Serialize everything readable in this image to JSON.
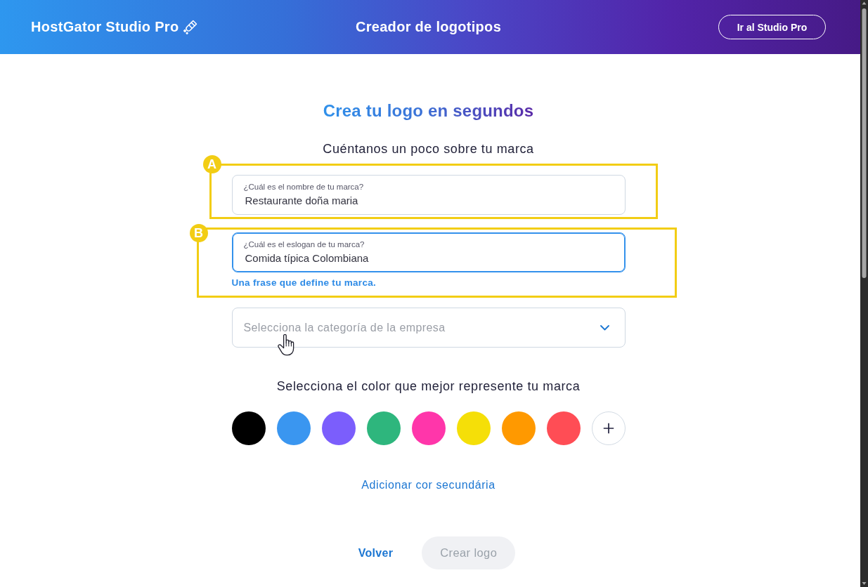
{
  "header": {
    "brand": "HostGator Studio Pro",
    "title": "Creador de logotipos",
    "action_button": "Ir al Studio Pro"
  },
  "form": {
    "heading": "Crea tu logo en segundos",
    "subheading": "Cuéntanos un poco sobre tu marca",
    "fields": [
      {
        "label": "¿Cuál es el nombre de tu marca?",
        "value": "Restaurante doña maria",
        "focused": false,
        "annotation": "A"
      },
      {
        "label": "¿Cuál es el eslogan de tu marca?",
        "value": "Comida típica Colombiana",
        "focused": true,
        "hint": "Una frase que define tu marca.",
        "annotation": "B"
      }
    ],
    "category_select": {
      "placeholder": "Selecciona la categoría de la empresa"
    },
    "color_heading": "Selecciona el color que mejor represente tu marca",
    "colors": [
      {
        "color": "#000000",
        "selected": false
      },
      {
        "color": "#3a96f0",
        "selected": false
      },
      {
        "color": "#7b5efc",
        "selected": false
      },
      {
        "color": "#2eb67d",
        "selected": false
      },
      {
        "color": "#ff36aa",
        "selected": false
      },
      {
        "color": "#f5df08",
        "selected": false
      },
      {
        "color": "#ff9900",
        "selected": false
      },
      {
        "color": "#ff4d55",
        "selected": false
      }
    ],
    "secondary_color_link": "Adicionar cor secundária",
    "back_link": "Volver",
    "submit_button": {
      "label": "Crear logo",
      "disabled": true
    }
  }
}
